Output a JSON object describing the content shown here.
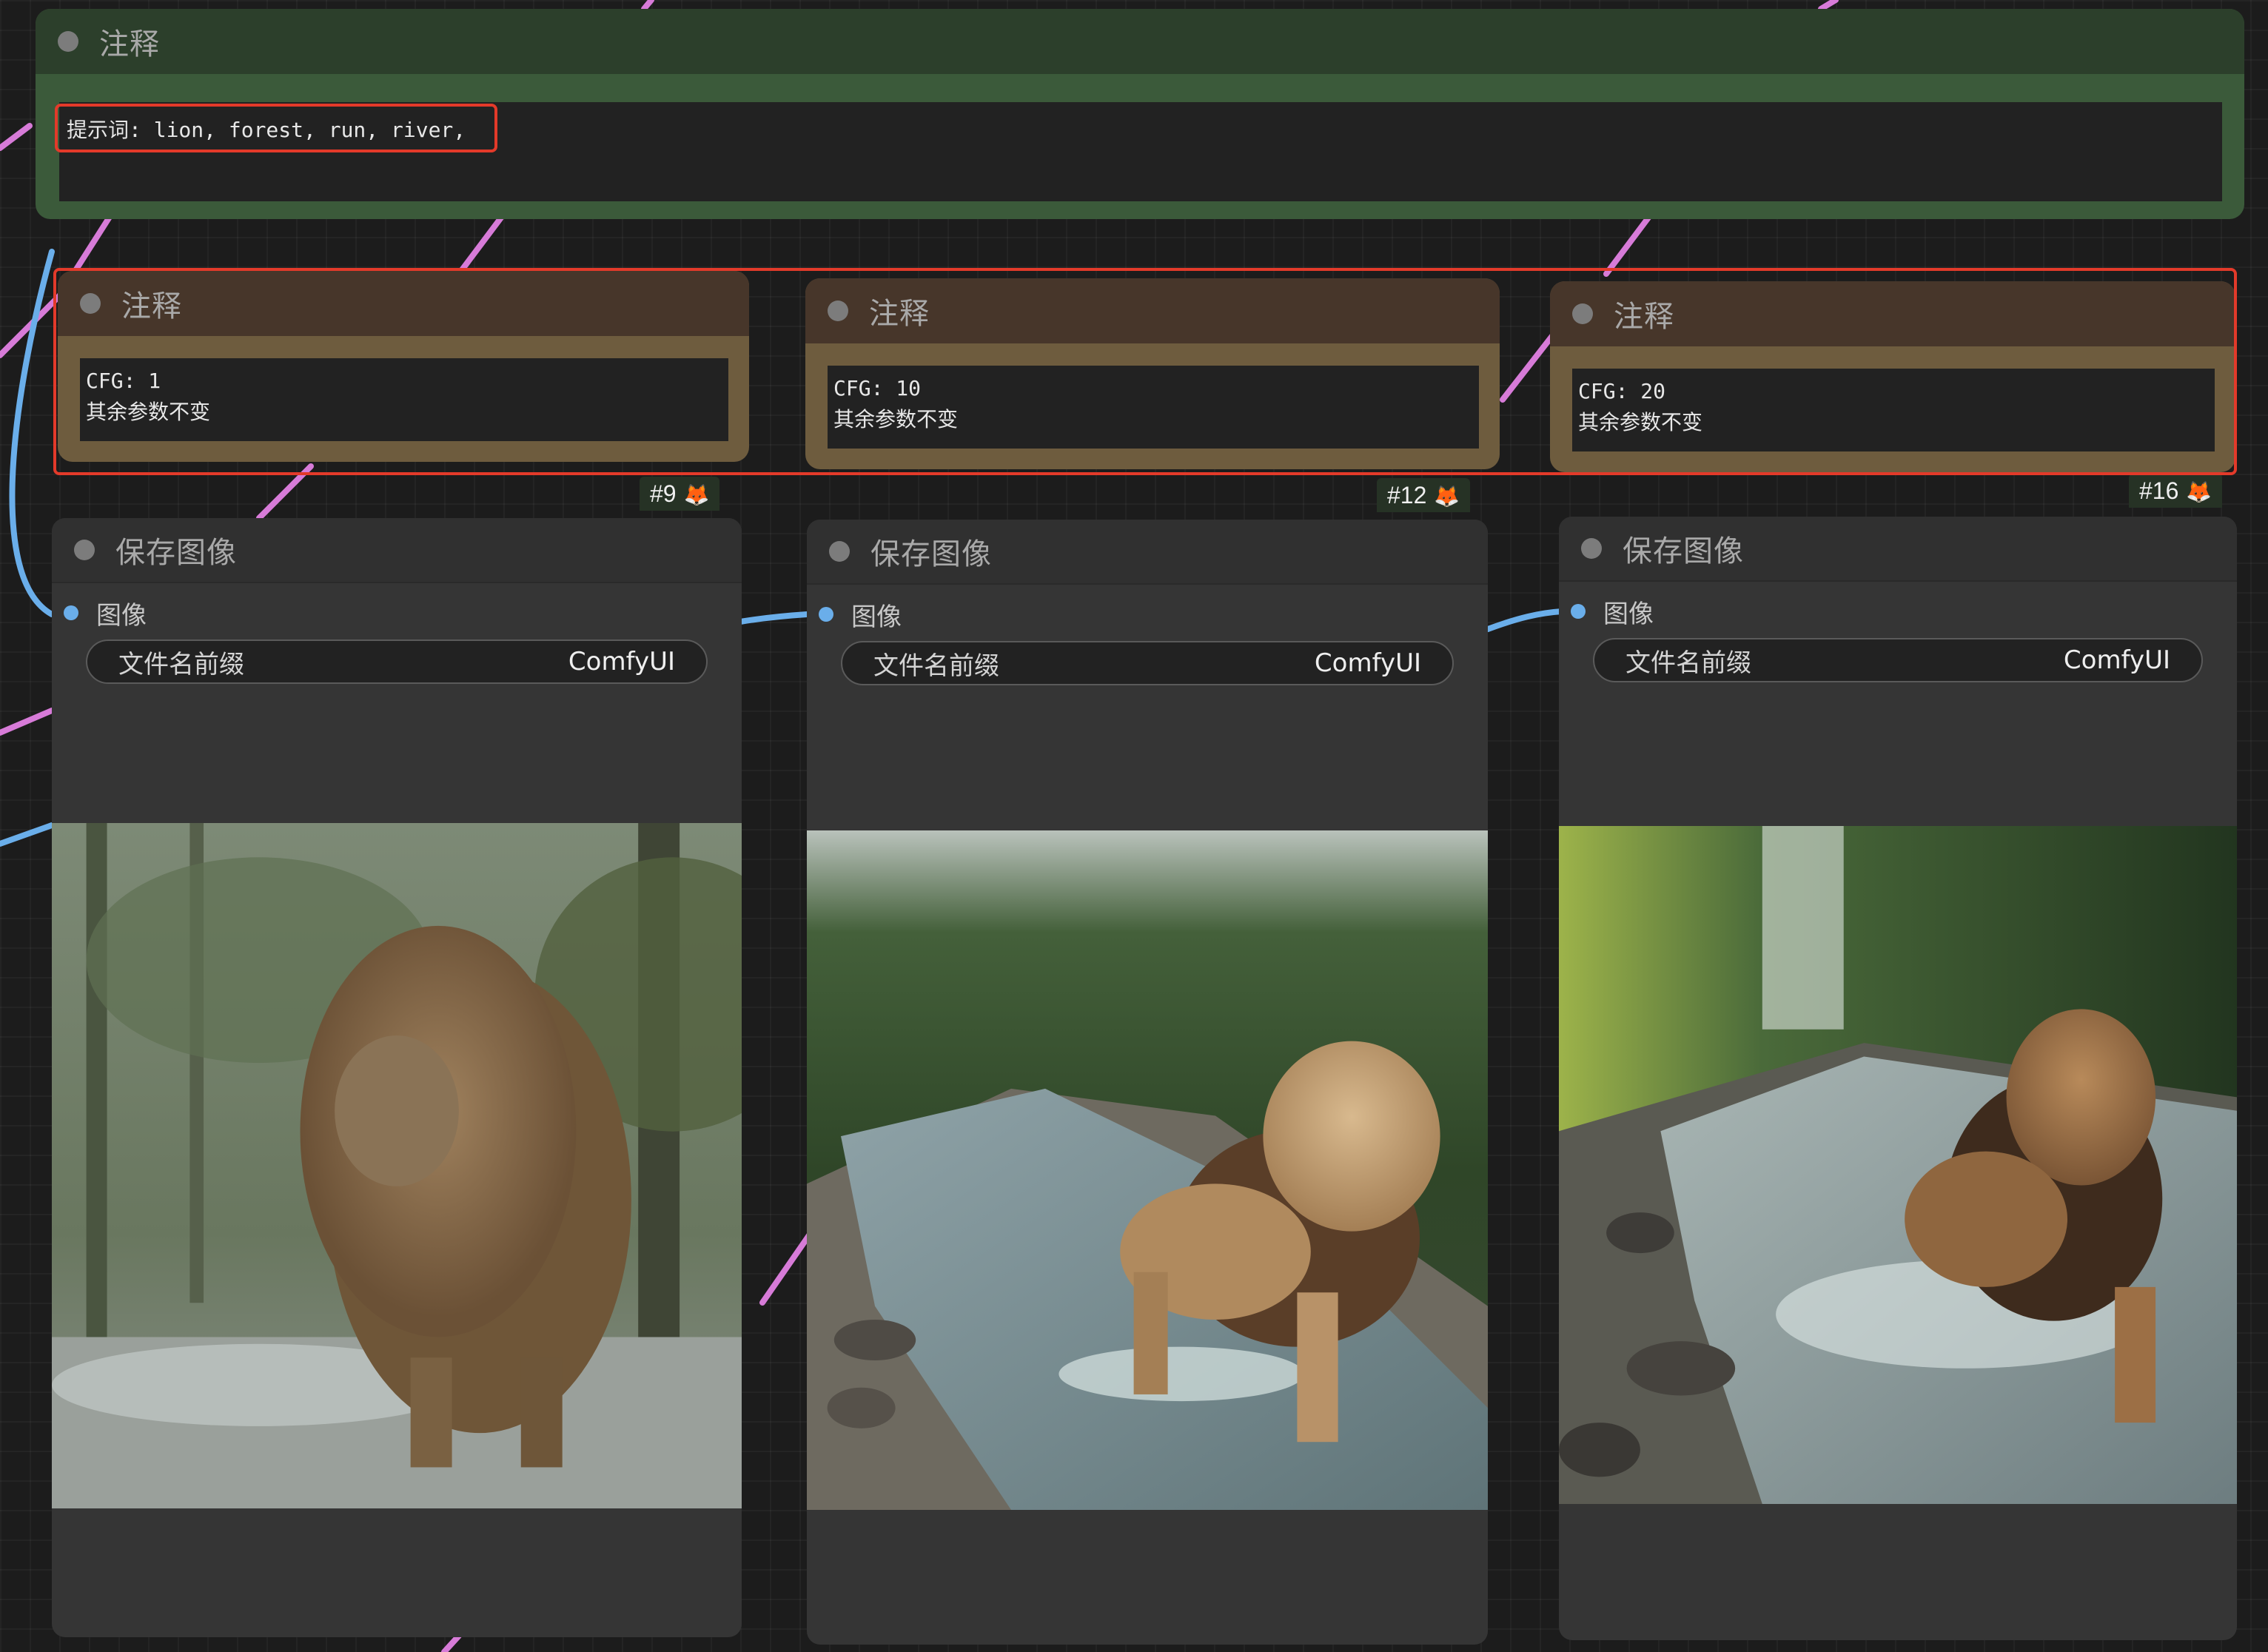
{
  "prompt_note": {
    "title": "注释",
    "text": "提示词: lion, forest, run, river,"
  },
  "cfg_notes": [
    {
      "title": "注释",
      "line1": "CFG: 1",
      "line2": "其余参数不变"
    },
    {
      "title": "注释",
      "line1": "CFG: 10",
      "line2": "其余参数不变"
    },
    {
      "title": "注释",
      "line1": "CFG: 20",
      "line2": "其余参数不变"
    }
  ],
  "badges": [
    "#9",
    "#12",
    "#16"
  ],
  "save_nodes": [
    {
      "title": "保存图像",
      "input_label": "图像",
      "widget_label": "文件名前缀",
      "widget_value": "ComfyUI"
    },
    {
      "title": "保存图像",
      "input_label": "图像",
      "widget_label": "文件名前缀",
      "widget_value": "ComfyUI"
    },
    {
      "title": "保存图像",
      "input_label": "图像",
      "widget_label": "文件名前缀",
      "widget_value": "ComfyUI"
    }
  ],
  "colors": {
    "note_green": "#3b5a3a",
    "note_brown": "#6e5c3e",
    "highlight": "#e33a2a",
    "wire_pink": "#d77bd8",
    "wire_blue": "#6aaeea"
  }
}
